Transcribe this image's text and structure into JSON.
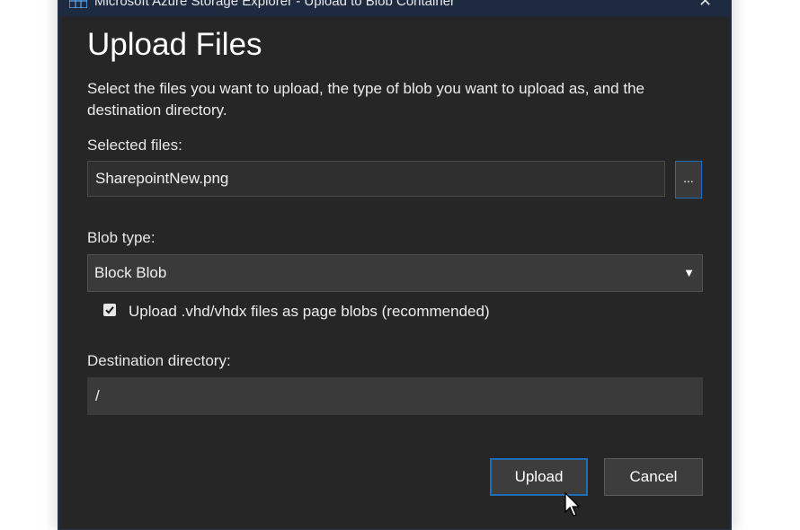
{
  "window": {
    "title": "Microsoft Azure Storage Explorer - Upload to Blob Container",
    "close_glyph": "✕"
  },
  "dialog": {
    "heading": "Upload Files",
    "description": "Select the files you want to upload, the type of blob you want to upload as, and the destination directory.",
    "selected_files": {
      "label": "Selected files:",
      "value": "SharepointNew.png",
      "browse_label": "..."
    },
    "blob_type": {
      "label": "Blob type:",
      "selected": "Block Blob",
      "caret": "▼"
    },
    "vhd_checkbox": {
      "checked": true,
      "label": "Upload .vhd/vhdx files as page blobs (recommended)"
    },
    "destination": {
      "label": "Destination directory:",
      "value": "/"
    },
    "buttons": {
      "upload": "Upload",
      "cancel": "Cancel"
    }
  },
  "colors": {
    "dialog_bg": "#262626",
    "accent": "#1e6fb8",
    "titlebar": "#1e2a3f"
  },
  "icons": {
    "app": "storage-explorer-icon",
    "close": "close-icon",
    "dropdown": "chevron-down-icon",
    "check": "checkmark-icon",
    "cursor": "mouse-pointer-icon"
  }
}
